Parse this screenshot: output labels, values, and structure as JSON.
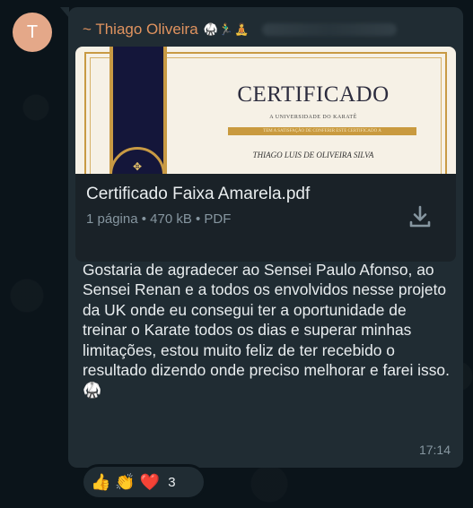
{
  "chat": {
    "avatar_initial": "T",
    "sender_name": "~ Thiago Oliveira",
    "sender_emoji": "🥋🏃‍♂️🧘",
    "document": {
      "preview": {
        "title": "CERTIFICADO",
        "subtitle": "A UNIVERSIDADE DO KARATÊ",
        "band_text": "TEM A SATISFAÇÃO DE CONFERIR ESTE CERTIFICADO A",
        "recipient": "THIAGO LUIS DE OLIVEIRA SILVA",
        "seal_icon": "✥"
      },
      "file_name": "Certificado Faixa Amarela.pdf",
      "file_meta": "1 página • 470 kB • PDF",
      "download_icon": "download-icon"
    },
    "message_text": "Gostaria de agradecer ao Sensei Paulo Afonso, ao Sensei Renan e a todos os envolvidos nesse projeto da UK onde eu consegui ter a oportunidade de treinar o Karate  todos os dias e superar minhas limitações, estou muito feliz de ter recebido o resultado dizendo onde preciso melhorar e farei isso.",
    "message_emoji": "🥋",
    "timestamp": "17:14",
    "reactions": {
      "items": [
        "👍",
        "👏",
        "❤️"
      ],
      "count": "3"
    }
  },
  "colors": {
    "background": "#0b141a",
    "bubble": "#202c33",
    "sender_name": "#e0935f",
    "avatar": "#e4a889",
    "meta_text": "#8696a0"
  }
}
